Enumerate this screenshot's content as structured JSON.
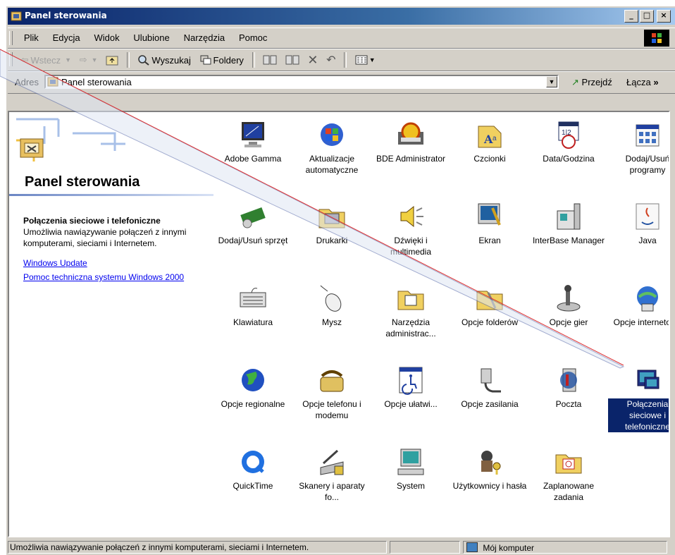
{
  "window": {
    "title": "Panel sterowania"
  },
  "menu": [
    "Plik",
    "Edycja",
    "Widok",
    "Ulubione",
    "Narzędzia",
    "Pomoc"
  ],
  "toolbar": {
    "back": "Wstecz",
    "search": "Wyszukaj",
    "folders": "Foldery"
  },
  "address": {
    "label": "Adres",
    "value": "Panel sterowania",
    "go": "Przejdź",
    "links": "Łącza"
  },
  "banner": {
    "title": "Panel sterowania"
  },
  "info": {
    "heading": "Połączenia sieciowe i telefoniczne",
    "description": "Umożliwia nawiązywanie połączeń z innymi komputerami, sieciami i Internetem.",
    "links": [
      "Windows Update",
      "Pomoc techniczna systemu Windows 2000"
    ]
  },
  "items": [
    {
      "label": "Adobe Gamma",
      "icon": "monitor-icon"
    },
    {
      "label": "Aktualizacje automatyczne",
      "icon": "windows-update-icon"
    },
    {
      "label": "BDE Administrator",
      "icon": "bde-icon"
    },
    {
      "label": "Czcionki",
      "icon": "fonts-icon"
    },
    {
      "label": "Data/Godzina",
      "icon": "calendar-clock-icon"
    },
    {
      "label": "Dodaj/Usuń programy",
      "icon": "add-remove-programs-icon"
    },
    {
      "label": "Dodaj/Usuń sprzęt",
      "icon": "hardware-icon"
    },
    {
      "label": "Drukarki",
      "icon": "printer-folder-icon"
    },
    {
      "label": "Dźwięki i multimedia",
      "icon": "speaker-icon"
    },
    {
      "label": "Ekran",
      "icon": "display-icon"
    },
    {
      "label": "InterBase Manager",
      "icon": "interbase-icon"
    },
    {
      "label": "Java",
      "icon": "java-icon"
    },
    {
      "label": "Klawiatura",
      "icon": "keyboard-icon"
    },
    {
      "label": "Mysz",
      "icon": "mouse-icon"
    },
    {
      "label": "Narzędzia administrac...",
      "icon": "admin-tools-icon"
    },
    {
      "label": "Opcje folderów",
      "icon": "folder-options-icon"
    },
    {
      "label": "Opcje gier",
      "icon": "joystick-icon"
    },
    {
      "label": "Opcje internetowe",
      "icon": "internet-options-icon"
    },
    {
      "label": "Opcje regionalne",
      "icon": "globe-icon"
    },
    {
      "label": "Opcje telefonu i modemu",
      "icon": "phone-icon"
    },
    {
      "label": "Opcje ułatwi...",
      "icon": "accessibility-icon"
    },
    {
      "label": "Opcje zasilania",
      "icon": "power-icon"
    },
    {
      "label": "Poczta",
      "icon": "mail-icon"
    },
    {
      "label": "Połączenia sieciowe i telefoniczne",
      "icon": "network-connections-icon",
      "selected": true
    },
    {
      "label": "QuickTime",
      "icon": "quicktime-icon"
    },
    {
      "label": "Skanery i aparaty fo...",
      "icon": "scanner-icon"
    },
    {
      "label": "System",
      "icon": "computer-icon"
    },
    {
      "label": "Użytkownicy i hasła",
      "icon": "users-passwords-icon"
    },
    {
      "label": "Zaplanowane zadania",
      "icon": "scheduled-tasks-icon"
    }
  ],
  "status": {
    "text": "Umożliwia nawiązywanie połączeń z innymi komputerami, sieciami i Internetem.",
    "zone": "Mój komputer"
  },
  "colors": {
    "title_bar": "#0a246a",
    "selection": "#0a246a",
    "link": "#0000ee"
  }
}
